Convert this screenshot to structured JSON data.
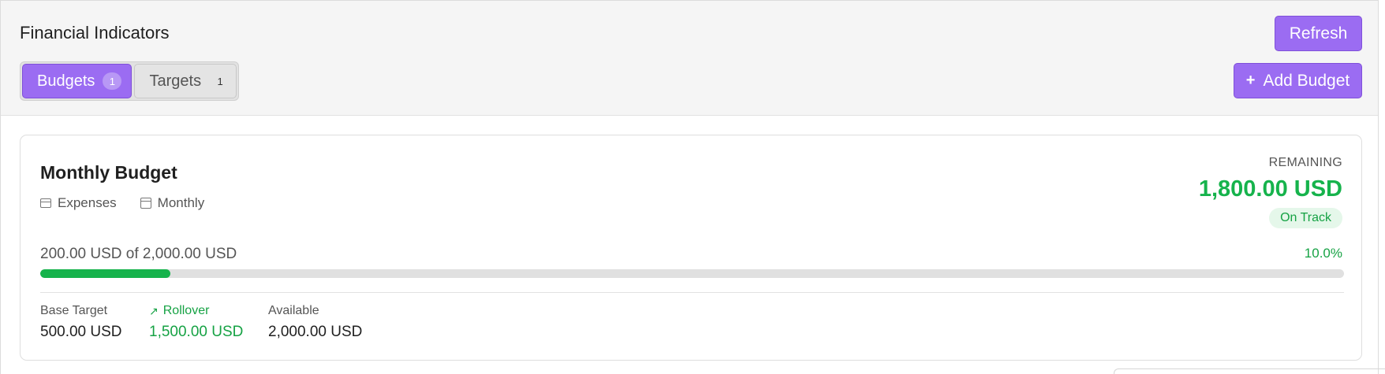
{
  "header": {
    "title": "Financial Indicators",
    "refresh_label": "Refresh",
    "add_budget_label": "Add Budget",
    "add_icon": "+"
  },
  "tabs": [
    {
      "label": "Budgets",
      "count": "1",
      "active": true
    },
    {
      "label": "Targets",
      "count": "1",
      "active": false
    }
  ],
  "budget_card": {
    "title": "Monthly Budget",
    "category": "Expenses",
    "period": "Monthly",
    "remaining_label": "REMAINING",
    "remaining_value": "1,800.00 USD",
    "status": "On Track",
    "progress_text": "200.00 USD of 2,000.00 USD",
    "progress_percent_text": "10.0%",
    "progress_fraction": 0.1,
    "stats": {
      "base_target_label": "Base Target",
      "base_target_value": "500.00 USD",
      "rollover_label": "Rollover",
      "rollover_value": "1,500.00 USD",
      "available_label": "Available",
      "available_value": "2,000.00 USD"
    }
  },
  "colors": {
    "accent": "#9b6cf2",
    "success": "#16b34c"
  },
  "icons": {
    "category": "credit-card-icon",
    "period": "calendar-icon",
    "rollover": "arrow-up-right-icon"
  }
}
